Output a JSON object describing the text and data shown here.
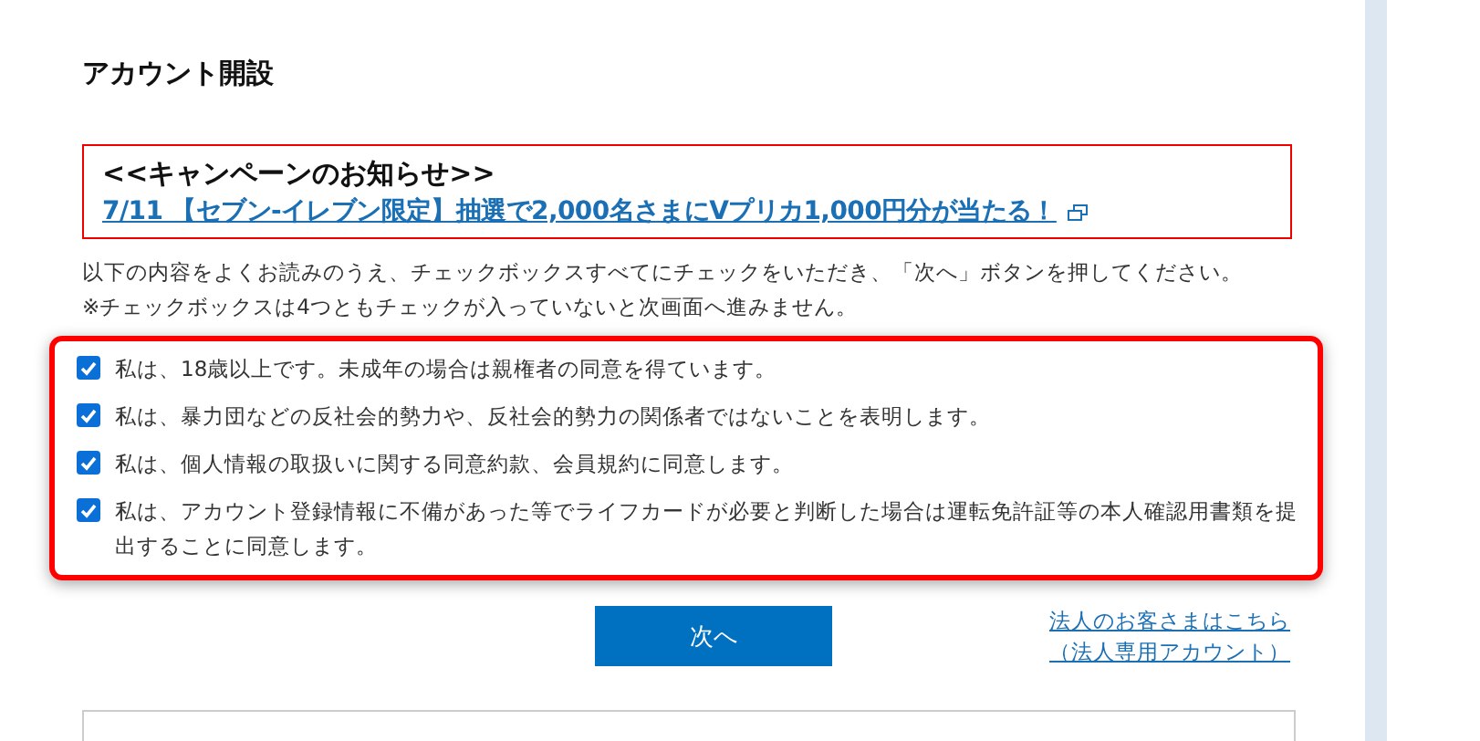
{
  "title": "アカウント開設",
  "campaign": {
    "heading": "<<キャンペーンのお知らせ>>",
    "link": "7/11 【セブン-イレブン限定】抽選で2,000名さまにVプリカ1,000円分が当たる！"
  },
  "instructions": [
    "以下の内容をよくお読みのうえ、チェックボックスすべてにチェックをいただき、「次へ」ボタンを押してください。",
    "※チェックボックスは4つともチェックが入っていないと次画面へ進みません。"
  ],
  "agreements": [
    {
      "label": "私は、18歳以上です。未成年の場合は親権者の同意を得ています。",
      "checked": true
    },
    {
      "label": "私は、暴力団などの反社会的勢力や、反社会的勢力の関係者ではないことを表明します。",
      "checked": true
    },
    {
      "label": "私は、個人情報の取扱いに関する同意約款、会員規約に同意します。",
      "checked": true
    },
    {
      "label": "私は、アカウント登録情報に不備があった等でライフカードが必要と判断した場合は運転免許証等の本人確認用書類を提出することに同意します。",
      "checked": true
    }
  ],
  "next_button": "次へ",
  "corporate_link": [
    "法人のお客さまはこちら",
    "（法人専用アカウント）"
  ]
}
